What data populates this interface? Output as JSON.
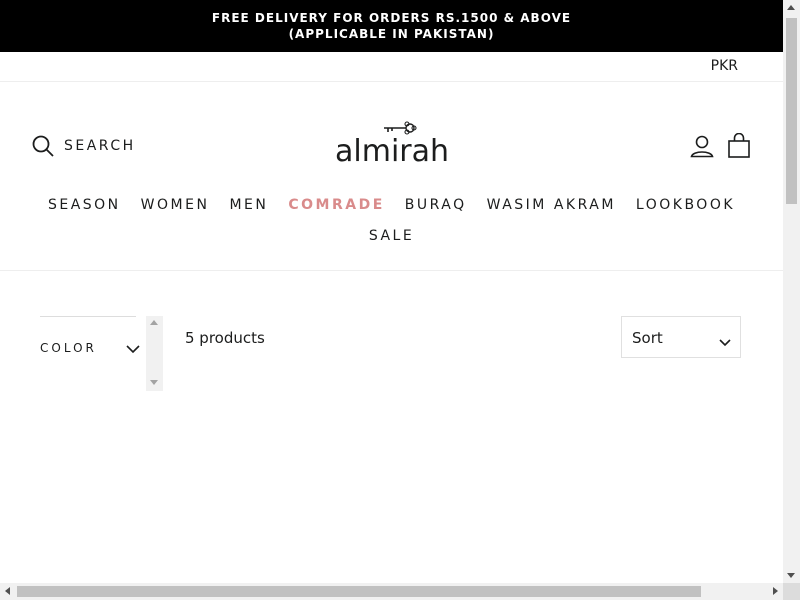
{
  "announcement": {
    "line1": "FREE DELIVERY FOR ORDERS RS.1500 & ABOVE",
    "line2": "(APPLICABLE IN PAKISTAN)"
  },
  "currency": "PKR",
  "header": {
    "search_label": "SEARCH",
    "logo_text": "almirah",
    "icons": {
      "search": "search-icon",
      "account": "account-icon",
      "cart": "cart-icon"
    }
  },
  "nav": {
    "items": [
      {
        "label": "SEASON"
      },
      {
        "label": "WOMEN"
      },
      {
        "label": "MEN"
      },
      {
        "label": "COMRADE"
      },
      {
        "label": "BURAQ"
      },
      {
        "label": "WASIM AKRAM"
      },
      {
        "label": "LOOKBOOK"
      },
      {
        "label": "SALE"
      }
    ],
    "accent_color": "#d98b8b"
  },
  "collection": {
    "filter_label": "COLOR",
    "product_count": "5 products",
    "sort_label": "Sort"
  }
}
